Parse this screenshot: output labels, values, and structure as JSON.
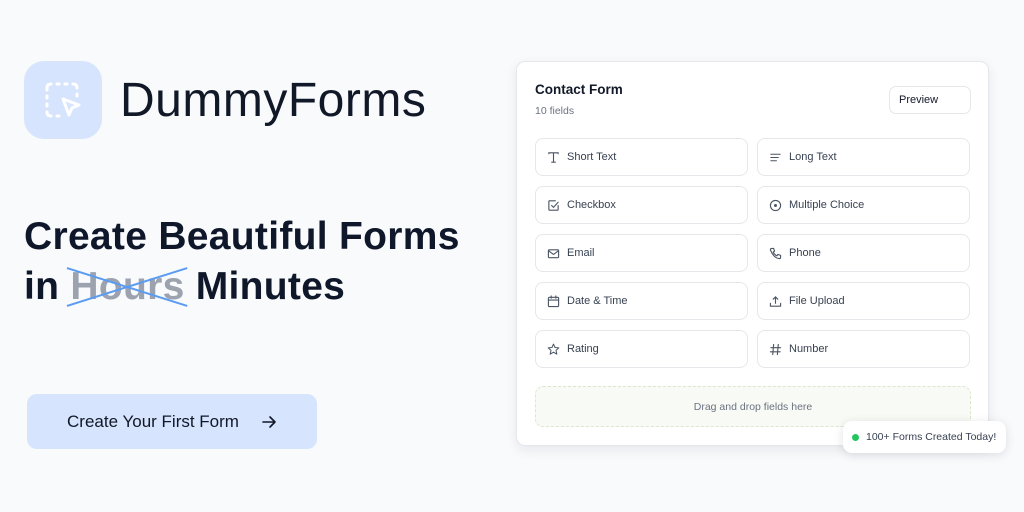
{
  "brand": {
    "name": "DummyForms",
    "logo_icon": "dashed-selection-cursor-icon",
    "accent_color": "#d6e4fd"
  },
  "hero": {
    "line1": "Create Beautiful Forms",
    "line2_prefix": "in",
    "struck_word": "Hours",
    "replacement_word": "Minutes",
    "strike_color": "#5b9cf2"
  },
  "cta": {
    "label": "Create Your First Form",
    "icon": "arrow-right-icon"
  },
  "form_card": {
    "title": "Contact Form",
    "subtitle": "10 fields",
    "preview_label": "Preview",
    "fields": [
      {
        "label": "Short Text",
        "icon": "text-t-icon"
      },
      {
        "label": "Long Text",
        "icon": "align-left-icon"
      },
      {
        "label": "Checkbox",
        "icon": "checkbox-icon"
      },
      {
        "label": "Multiple Choice",
        "icon": "radio-icon"
      },
      {
        "label": "Email",
        "icon": "mail-icon"
      },
      {
        "label": "Phone",
        "icon": "phone-icon"
      },
      {
        "label": "Date & Time",
        "icon": "calendar-icon"
      },
      {
        "label": "File Upload",
        "icon": "upload-icon"
      },
      {
        "label": "Rating",
        "icon": "star-icon"
      },
      {
        "label": "Number",
        "icon": "hash-icon"
      }
    ],
    "dropzone_label": "Drag and drop fields here"
  },
  "toast": {
    "label": "100+ Forms Created Today!",
    "status_color": "#22c55e"
  }
}
